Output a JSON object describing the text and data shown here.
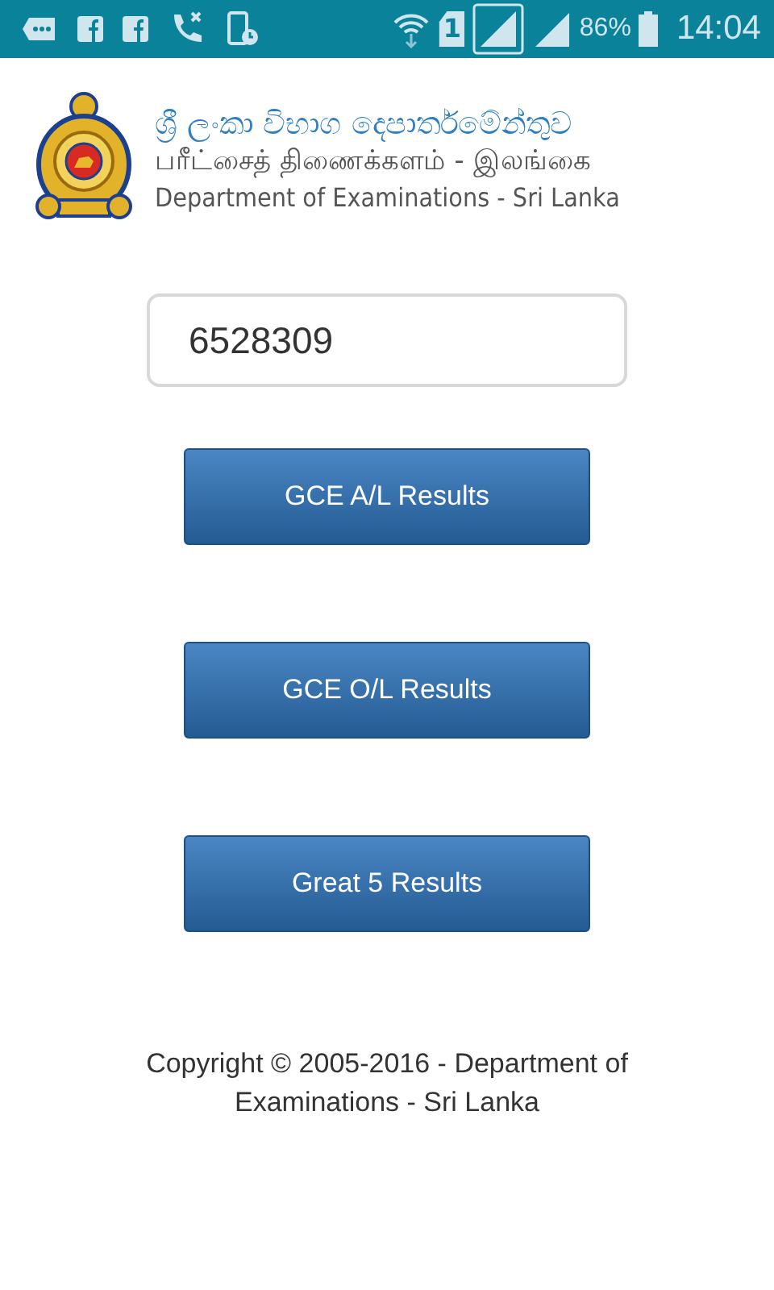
{
  "status_bar": {
    "sim_slot": "1",
    "battery": "86%",
    "time": "14:04"
  },
  "header": {
    "sinhala": "ශ්‍රී ලංකා විභාග දෙපාර්තමේන්තුව",
    "tamil": "பரீட்சைத் திணைக்களம் - இலங்கை",
    "english": "Department of Examinations - Sri Lanka"
  },
  "index_field": {
    "value": "6528309"
  },
  "buttons": [
    "GCE A/L Results",
    "GCE O/L Results",
    "Great 5 Results"
  ],
  "footer": "Copyright © 2005-2016 - Department of Examinations - Sri Lanka"
}
